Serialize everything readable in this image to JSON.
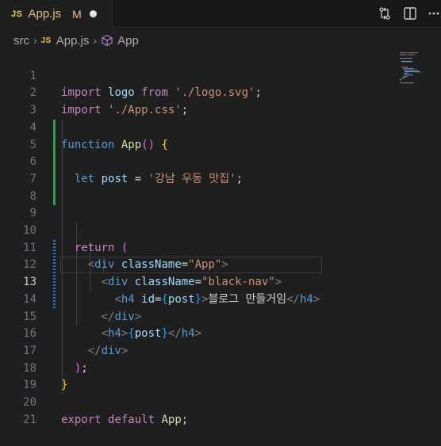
{
  "tab": {
    "badge": "JS",
    "title": "App.js",
    "modified": "M"
  },
  "breadcrumb": {
    "folder": "src",
    "file_badge": "JS",
    "file": "App.js",
    "symbol": "App"
  },
  "lines": [
    {
      "n": "1"
    },
    {
      "n": "2"
    },
    {
      "n": "3"
    },
    {
      "n": "4"
    },
    {
      "n": "5"
    },
    {
      "n": "6"
    },
    {
      "n": "7"
    },
    {
      "n": "8"
    },
    {
      "n": "9"
    },
    {
      "n": "10"
    },
    {
      "n": "11"
    },
    {
      "n": "12"
    },
    {
      "n": "13"
    },
    {
      "n": "14"
    },
    {
      "n": "15"
    },
    {
      "n": "16"
    },
    {
      "n": "17"
    },
    {
      "n": "18"
    },
    {
      "n": "19"
    },
    {
      "n": "20"
    },
    {
      "n": "21"
    }
  ],
  "code": {
    "l1": [
      "import",
      "logo",
      "from",
      "'./logo.svg'",
      ";"
    ],
    "l2": [
      "import",
      "'./App.css'",
      ";"
    ],
    "l4": [
      "function",
      "App",
      "()",
      "{"
    ],
    "l6": [
      "let",
      "post",
      "=",
      "'강남 우동 맛집'",
      ";"
    ],
    "l10": [
      "return",
      "("
    ],
    "l11": [
      "<",
      "div",
      "className",
      "=",
      "\"App\"",
      ">"
    ],
    "l12": [
      "<",
      "div",
      "className",
      "=",
      "\"black-nav\"",
      ">"
    ],
    "l13": [
      "<",
      "h4",
      "id",
      "=",
      "{",
      "post",
      "}",
      ">",
      "블로그 만들거임",
      "</",
      "h4",
      ">"
    ],
    "l14": [
      "</",
      "div",
      ">"
    ],
    "l15": [
      "<",
      "h4",
      ">",
      "{",
      "post",
      "}",
      "</",
      "h4",
      ">"
    ],
    "l16": [
      "</",
      "div",
      ">"
    ],
    "l17": [
      ")",
      ";"
    ],
    "l18": [
      "}"
    ],
    "l20": [
      "export",
      "default",
      "App",
      ";"
    ]
  },
  "active_line": "13",
  "colors": {
    "background": "#1f1f1f",
    "keyword": "#c586c0",
    "string": "#ce9178",
    "variable": "#9cdcfe",
    "modified_text": "#e2c08d",
    "gutter_added": "#2ea043",
    "gutter_modified": "#1f6feb"
  },
  "icons": [
    "compare-changes-icon",
    "split-editor-icon",
    "more-actions-icon",
    "symbol-method-icon"
  ]
}
